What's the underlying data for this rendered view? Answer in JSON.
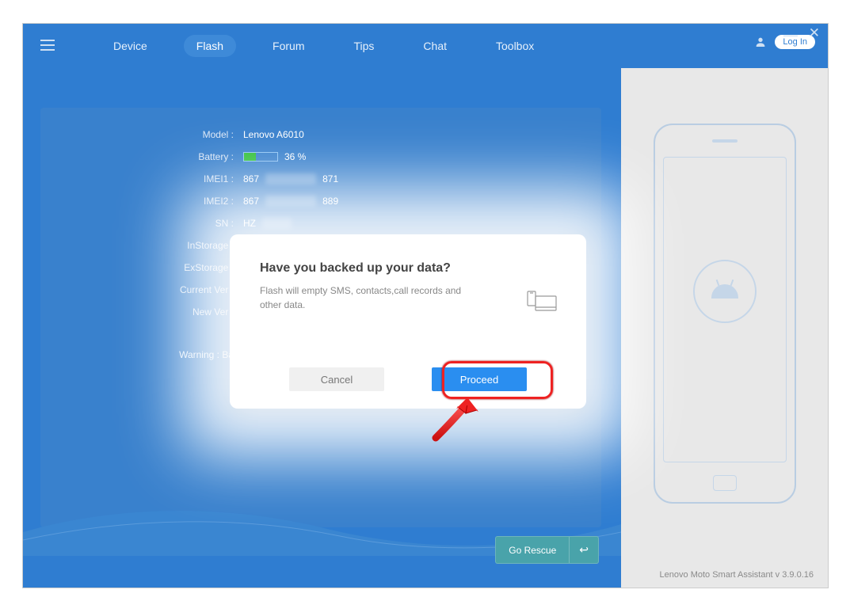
{
  "nav": {
    "items": [
      "Device",
      "Flash",
      "Forum",
      "Tips",
      "Chat",
      "Toolbox"
    ],
    "active_index": 1
  },
  "login_label": "Log In",
  "device_info": {
    "model_label": "Model :",
    "model_value": "Lenovo A6010",
    "battery_label": "Battery :",
    "battery_percent_text": "36 %",
    "battery_percent": 36,
    "imei1_label": "IMEI1 :",
    "imei1_value_prefix": "867",
    "imei1_value_suffix": "871",
    "imei2_label": "IMEI2 :",
    "imei2_value_prefix": "867",
    "imei2_value_suffix": "889",
    "sn_label": "SN :",
    "sn_value_prefix": "HZ",
    "instorage_label": "InStorage :",
    "exstorage_label": "ExStorage :",
    "currentver_label": "Current Ver :",
    "newver_label": "New Ver :",
    "warning_label": "Warning : Ba"
  },
  "go_rescue_label": "Go Rescue",
  "modal": {
    "title": "Have you backed up your data?",
    "body": "Flash will empty SMS, contacts,call records and other data.",
    "cancel": "Cancel",
    "proceed": "Proceed"
  },
  "version_text": "Lenovo Moto Smart Assistant v 3.9.0.16"
}
